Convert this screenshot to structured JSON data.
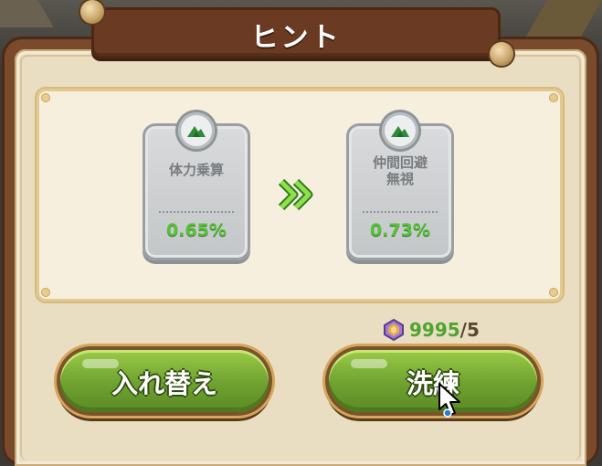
{
  "dialog": {
    "title": "ヒント"
  },
  "stats": {
    "before": {
      "name": "体力乗算",
      "value": "0.65%"
    },
    "after": {
      "name_line1": "仲間回避",
      "name_line2": "無視",
      "value": "0.73%"
    }
  },
  "cost": {
    "amount": "9995",
    "limit": "/5"
  },
  "buttons": {
    "swap_label": "入れ替え",
    "refine_label": "洗練"
  },
  "icons": {
    "stat_badge": "mountain-icon",
    "arrow": "double-chevron-right-icon",
    "currency": "gem-icon",
    "cursor": "mouse-pointer-icon"
  },
  "colors": {
    "value_green": "#57c23a",
    "button_green": "#6ea130",
    "cost_green": "#4ca52e",
    "title_bar": "#6a3a22"
  }
}
